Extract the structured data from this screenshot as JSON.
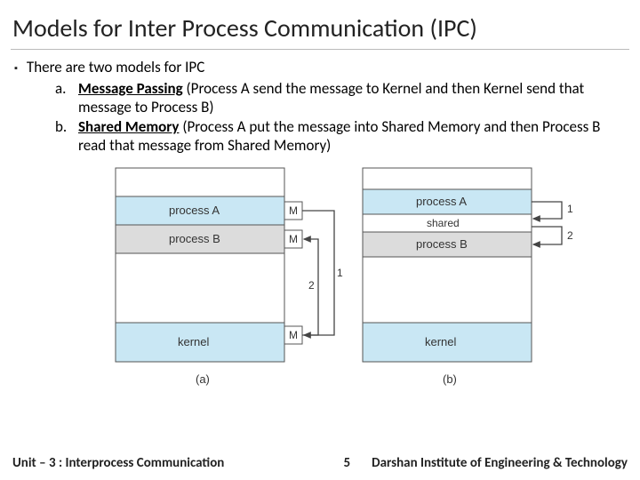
{
  "title": "Models for Inter Process Communication (IPC)",
  "bullet_text": "There are two models for IPC",
  "sub": {
    "a": {
      "label": "a.",
      "keyword": "Message Passing",
      "rest": " (Process A send the message to Kernel and then Kernel send that message to Process B)"
    },
    "b": {
      "label": "b.",
      "keyword": "Shared Memory",
      "rest": " (Process A put the message into Shared Memory and then Process B read that message from Shared Memory)"
    }
  },
  "fig": {
    "processA": "process A",
    "processB": "process B",
    "kernel": "kernel",
    "shared": "shared",
    "M": "M",
    "one": "1",
    "two": "2",
    "labA": "(a)",
    "labB": "(b)"
  },
  "footer": {
    "left": "Unit – 3 : Interprocess Communication",
    "page": "5",
    "right": "Darshan Institute of Engineering & Technology"
  }
}
